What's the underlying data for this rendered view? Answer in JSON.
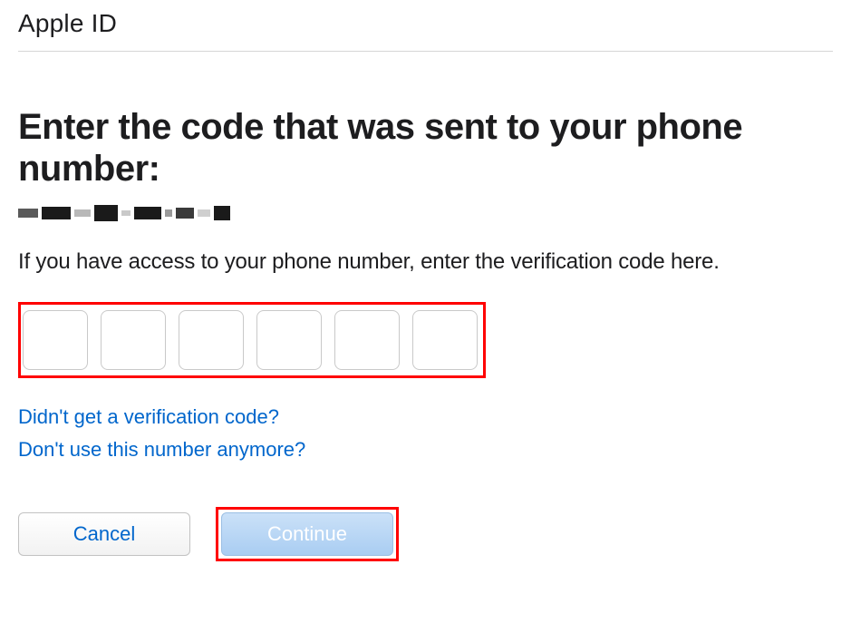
{
  "header": {
    "title": "Apple ID"
  },
  "main": {
    "heading": "Enter the code that was sent to your phone number:",
    "instruction": "If you have access to your phone number, enter the verification code here."
  },
  "code_inputs": {
    "count": 6,
    "values": [
      "",
      "",
      "",
      "",
      "",
      ""
    ]
  },
  "links": {
    "resend": "Didn't get a verification code?",
    "no_number": "Don't use this number anymore?"
  },
  "buttons": {
    "cancel": "Cancel",
    "continue": "Continue"
  }
}
